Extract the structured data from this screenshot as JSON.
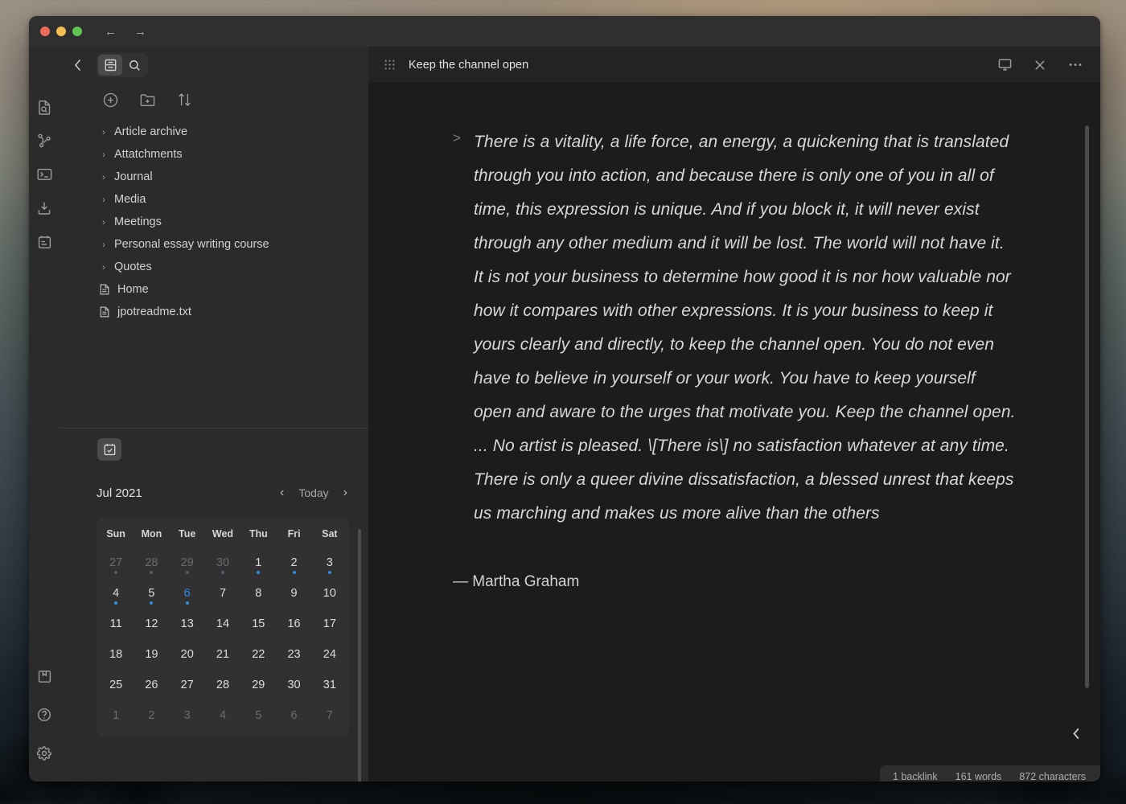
{
  "window": {
    "traffic_lights": [
      "close",
      "minimize",
      "zoom"
    ],
    "nav_back": "←",
    "nav_forward": "→"
  },
  "rail": {
    "items": [
      {
        "name": "file-search-icon",
        "label": "Quick switcher"
      },
      {
        "name": "graph-icon",
        "label": "Graph view"
      },
      {
        "name": "terminal-icon",
        "label": "Terminal"
      },
      {
        "name": "import-icon",
        "label": "Import"
      },
      {
        "name": "tasks-icon",
        "label": "Tasks"
      }
    ],
    "bottom_items": [
      {
        "name": "vault-icon",
        "label": "Open another vault"
      },
      {
        "name": "help-icon",
        "label": "Help"
      },
      {
        "name": "settings-icon",
        "label": "Settings"
      }
    ]
  },
  "sidebar": {
    "back_label": "Back",
    "tabs": [
      {
        "name": "files-tab",
        "label": "Files",
        "active": true
      },
      {
        "name": "search-tab",
        "label": "Search",
        "active": false
      }
    ],
    "actions": [
      {
        "name": "new-note-button",
        "label": "New note"
      },
      {
        "name": "new-folder-button",
        "label": "New folder"
      },
      {
        "name": "sort-button",
        "label": "Change sort order"
      }
    ],
    "tree": [
      {
        "label": "Article archive",
        "type": "folder"
      },
      {
        "label": "Attatchments",
        "type": "folder"
      },
      {
        "label": "Journal",
        "type": "folder"
      },
      {
        "label": "Media",
        "type": "folder"
      },
      {
        "label": "Meetings",
        "type": "folder"
      },
      {
        "label": "Personal essay writing course",
        "type": "folder"
      },
      {
        "label": "Quotes",
        "type": "folder"
      },
      {
        "label": "Home",
        "type": "file"
      },
      {
        "label": "jpotreadme.txt",
        "type": "file"
      }
    ],
    "calendar_tab": {
      "name": "calendar-tab",
      "label": "Calendar"
    }
  },
  "calendar": {
    "month_label": "Jul 2021",
    "prev_label": "‹",
    "today_label": "Today",
    "next_label": "›",
    "weekdays": [
      "Sun",
      "Mon",
      "Tue",
      "Wed",
      "Thu",
      "Fri",
      "Sat"
    ],
    "today": 6,
    "accent_color": "#2f8de4",
    "weeks": [
      [
        {
          "day": 27,
          "muted": true,
          "dot": true
        },
        {
          "day": 28,
          "muted": true,
          "dot": true
        },
        {
          "day": 29,
          "muted": true,
          "dot": true
        },
        {
          "day": 30,
          "muted": true,
          "dot": true
        },
        {
          "day": 1,
          "muted": false,
          "dot": true
        },
        {
          "day": 2,
          "muted": false,
          "dot": true
        },
        {
          "day": 3,
          "muted": false,
          "dot": true
        }
      ],
      [
        {
          "day": 4,
          "muted": false,
          "dot": true
        },
        {
          "day": 5,
          "muted": false,
          "dot": true
        },
        {
          "day": 6,
          "muted": false,
          "dot": true,
          "today": true
        },
        {
          "day": 7,
          "muted": false,
          "dot": false
        },
        {
          "day": 8,
          "muted": false,
          "dot": false
        },
        {
          "day": 9,
          "muted": false,
          "dot": false
        },
        {
          "day": 10,
          "muted": false,
          "dot": false
        }
      ],
      [
        {
          "day": 11,
          "muted": false,
          "dot": false
        },
        {
          "day": 12,
          "muted": false,
          "dot": false
        },
        {
          "day": 13,
          "muted": false,
          "dot": false
        },
        {
          "day": 14,
          "muted": false,
          "dot": false
        },
        {
          "day": 15,
          "muted": false,
          "dot": false
        },
        {
          "day": 16,
          "muted": false,
          "dot": false
        },
        {
          "day": 17,
          "muted": false,
          "dot": false
        }
      ],
      [
        {
          "day": 18,
          "muted": false,
          "dot": false
        },
        {
          "day": 19,
          "muted": false,
          "dot": false
        },
        {
          "day": 20,
          "muted": false,
          "dot": false
        },
        {
          "day": 21,
          "muted": false,
          "dot": false
        },
        {
          "day": 22,
          "muted": false,
          "dot": false
        },
        {
          "day": 23,
          "muted": false,
          "dot": false
        },
        {
          "day": 24,
          "muted": false,
          "dot": false
        }
      ],
      [
        {
          "day": 25,
          "muted": false,
          "dot": false
        },
        {
          "day": 26,
          "muted": false,
          "dot": false
        },
        {
          "day": 27,
          "muted": false,
          "dot": false
        },
        {
          "day": 28,
          "muted": false,
          "dot": false
        },
        {
          "day": 29,
          "muted": false,
          "dot": false
        },
        {
          "day": 30,
          "muted": false,
          "dot": false
        },
        {
          "day": 31,
          "muted": false,
          "dot": false
        }
      ],
      [
        {
          "day": 1,
          "muted": true,
          "dot": false
        },
        {
          "day": 2,
          "muted": true,
          "dot": false
        },
        {
          "day": 3,
          "muted": true,
          "dot": false
        },
        {
          "day": 4,
          "muted": true,
          "dot": false
        },
        {
          "day": 5,
          "muted": true,
          "dot": false
        },
        {
          "day": 6,
          "muted": true,
          "dot": false
        },
        {
          "day": 7,
          "muted": true,
          "dot": false
        }
      ]
    ]
  },
  "editor": {
    "title": "Keep the channel open",
    "header_actions": [
      {
        "name": "presentation-icon",
        "label": "Presentation mode"
      },
      {
        "name": "close-icon",
        "label": "Close"
      },
      {
        "name": "more-options-icon",
        "label": "More options"
      }
    ],
    "quote_marker": ">",
    "quote_text": "There is a vitality, a life force, an energy, a quickening that is translated through you into action, and because there is only one of you in all of time, this expression is unique. And if you block it, it will never exist through any other medium and it will be lost. The world will not have it. It is not your business to determine how good it is nor how valuable nor how it compares with other expressions. It is your business to keep it yours clearly and directly, to keep the channel open. You do not even have to believe in yourself or your work. You have to keep yourself open and aware to the urges that motivate you. Keep the channel open. ... No artist is pleased. \\[There is\\] no satisfaction whatever at any time. There is only a queer divine dissatisfaction, a blessed unrest that keeps us marching and makes us more alive than the others",
    "attribution": "— Martha Graham",
    "collapse_label": "‹"
  },
  "status": {
    "backlinks": "1 backlink",
    "words": "161 words",
    "characters": "872 characters"
  }
}
